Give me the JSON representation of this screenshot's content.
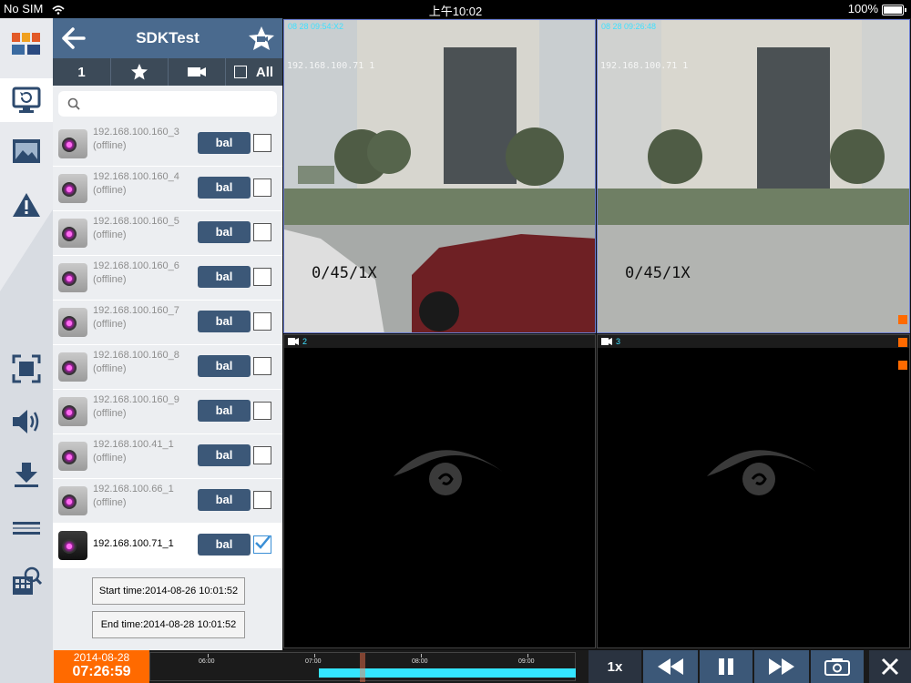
{
  "status": {
    "carrier": "No SIM",
    "time": "上午10:02",
    "battery": "100%"
  },
  "panel": {
    "title": "SDKTest",
    "tabs": {
      "number": "1",
      "all": "All"
    },
    "search_placeholder": "",
    "devices": [
      {
        "name": "192.168.100.160_3",
        "status": "(offline)",
        "button": "bal",
        "checked": false
      },
      {
        "name": "192.168.100.160_4",
        "status": "(offline)",
        "button": "bal",
        "checked": false
      },
      {
        "name": "192.168.100.160_5",
        "status": "(offline)",
        "button": "bal",
        "checked": false
      },
      {
        "name": "192.168.100.160_6",
        "status": "(offline)",
        "button": "bal",
        "checked": false
      },
      {
        "name": "192.168.100.160_7",
        "status": "(offline)",
        "button": "bal",
        "checked": false
      },
      {
        "name": "192.168.100.160_8",
        "status": "(offline)",
        "button": "bal",
        "checked": false
      },
      {
        "name": "192.168.100.160_9",
        "status": "(offline)",
        "button": "bal",
        "checked": false
      },
      {
        "name": "192.168.100.41_1",
        "status": "(offline)",
        "button": "bal",
        "checked": false
      },
      {
        "name": "192.168.100.66_1",
        "status": "(offline)",
        "button": "bal",
        "checked": false
      },
      {
        "name": "192.168.100.71_1",
        "status": "",
        "button": "bal",
        "checked": true
      }
    ],
    "start_time": "Start time:2014-08-26 10:01:52",
    "end_time": "End time:2014-08-28 10:01:52"
  },
  "video": {
    "cells": [
      {
        "label": "08 28 09:54:X2",
        "ip": "192.168.100.71 1",
        "osd": "0/45/1X"
      },
      {
        "label": "08 28 09:26:48",
        "ip": "192.168.100.71 1",
        "osd": "0/45/1X"
      },
      {
        "label": "2"
      },
      {
        "label": "3"
      }
    ]
  },
  "timeline": {
    "date": "2014-08-28",
    "time": "07:26:59",
    "ticks": [
      "06:00",
      "07:00",
      "08:00",
      "09:00"
    ],
    "speed": "1x"
  },
  "colors": {
    "accent": "#ff6a00",
    "header": "#4a6a8e",
    "playback": "#34e5ff"
  }
}
